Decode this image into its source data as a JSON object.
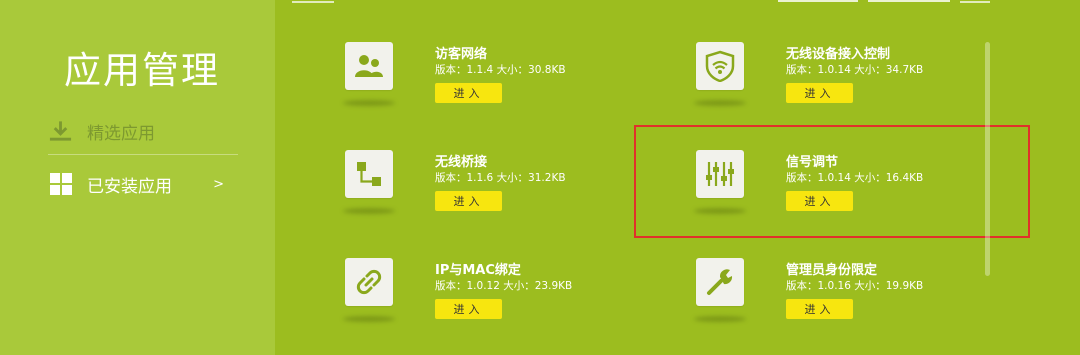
{
  "sidebar": {
    "title": "应用管理",
    "items": [
      {
        "label": "精选应用",
        "icon": "download-icon"
      },
      {
        "label": "已安装应用",
        "icon": "grid-icon",
        "arrow": ">"
      }
    ]
  },
  "apps": [
    {
      "name": "访客网络",
      "version": "版本：1.1.4",
      "size": "大小：30.8KB",
      "button": "进入",
      "icon": "guest-users-icon"
    },
    {
      "name": "无线设备接入控制",
      "version": "版本：1.0.14",
      "size": "大小：34.7KB",
      "button": "进入",
      "icon": "wifi-shield-icon"
    },
    {
      "name": "无线桥接",
      "version": "版本：1.1.6",
      "size": "大小：31.2KB",
      "button": "进入",
      "icon": "bridge-icon"
    },
    {
      "name": "信号调节",
      "version": "版本：1.0.14",
      "size": "大小：16.4KB",
      "button": "进入",
      "icon": "sliders-icon"
    },
    {
      "name": "IP与MAC绑定",
      "version": "版本：1.0.12",
      "size": "大小：23.9KB",
      "button": "进入",
      "icon": "link-icon"
    },
    {
      "name": "管理员身份限定",
      "version": "版本：1.0.16",
      "size": "大小：19.9KB",
      "button": "进入",
      "icon": "wrench-icon"
    }
  ],
  "colors": {
    "background": "#9cbd1f",
    "sidebar": "#a9c93a",
    "button": "#f7e60f",
    "highlight": "#e0312b"
  }
}
